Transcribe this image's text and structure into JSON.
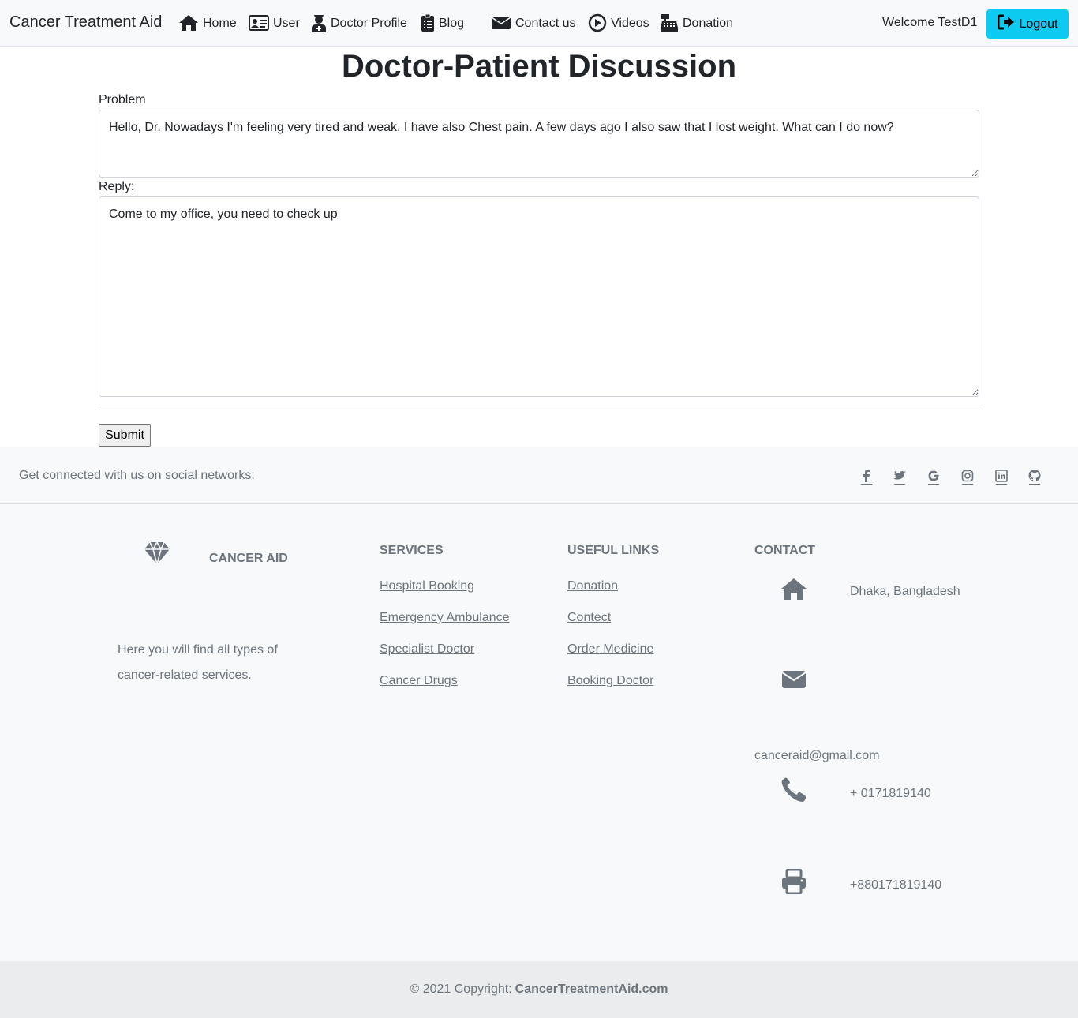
{
  "navbar": {
    "brand": "Cancer Treatment Aid",
    "items": [
      {
        "label": "Home",
        "icon": "home-icon"
      },
      {
        "label": "User",
        "icon": "id-card-icon"
      },
      {
        "label": "Doctor Profile",
        "icon": "doctor-icon"
      },
      {
        "label": "Blog",
        "icon": "clipboard-list-icon"
      },
      {
        "label": "Contact us",
        "icon": "envelope-icon"
      },
      {
        "label": "Videos",
        "icon": "play-circle-icon"
      },
      {
        "label": "Donation",
        "icon": "cash-register-icon"
      }
    ],
    "welcome": "Welcome TestD1",
    "logout_label": "Logout",
    "logout_color": "#0dcaf0"
  },
  "main": {
    "title": "Doctor-Patient Discussion",
    "problem_label": "Problem",
    "problem_value": "Hello, Dr. Nowadays I'm feeling very tired and weak. I have also Chest pain. A few days ago I also saw that I lost weight. What can I do now?",
    "reply_label": "Reply:",
    "reply_value": "Come to my office, you need to check up",
    "submit_label": "Submit"
  },
  "footer": {
    "social_text": "Get connected with us on social networks:",
    "social_icons": [
      "facebook-icon",
      "twitter-icon",
      "google-icon",
      "instagram-icon",
      "linkedin-icon",
      "github-icon"
    ],
    "brand": {
      "icon": "gem-icon",
      "title": "CANCER AID",
      "description": "Here you will find all types of cancer-related services."
    },
    "services": {
      "heading": "SERVICES",
      "links": [
        "Hospital Booking",
        "Emergency Ambulance",
        "Specialist Doctor",
        "Cancer Drugs"
      ]
    },
    "useful_links": {
      "heading": "USEFUL LINKS",
      "links": [
        "Donation",
        "Contect",
        "Order Medicine",
        "Booking Doctor"
      ]
    },
    "contact": {
      "heading": "CONTACT",
      "address": "Dhaka, Bangladesh",
      "email": "canceraid@gmail.com",
      "phone": "+ 0171819140",
      "fax": "+880171819140"
    },
    "copyright_prefix": "© 2021 Copyright:",
    "copyright_link": "CancerTreatmentAid.com"
  }
}
